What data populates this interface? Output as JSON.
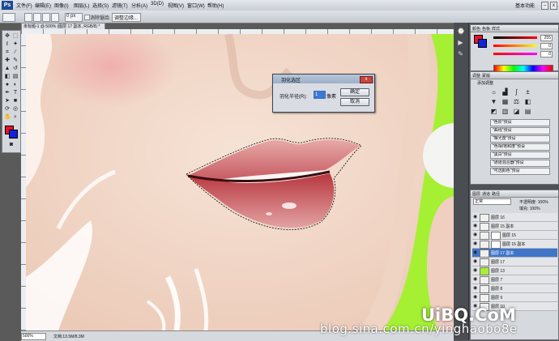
{
  "app": {
    "logo": "Ps",
    "workspace": "基本功能"
  },
  "menu": [
    "文件(F)",
    "编辑(E)",
    "图像(I)",
    "图层(L)",
    "选择(S)",
    "滤镜(T)",
    "分析(A)",
    "3D(D)",
    "视图(V)",
    "窗口(W)",
    "帮助(H)"
  ],
  "options": {
    "feather_value": "0 px",
    "antialias_label": "消除锯齿",
    "refine_edge_label": "调整边缘..."
  },
  "document": {
    "tab_title": "未标题-1 @ 500% (图层 17 副本, RGB/8) *",
    "zoom": "500%",
    "doc_size": "文档:13.5M/8.3M"
  },
  "dialog": {
    "title": "羽化选区",
    "close_label": "x",
    "field_label": "羽化半径(R):",
    "field_value": "1",
    "unit": "像素",
    "ok_label": "确定",
    "cancel_label": "取消"
  },
  "panels": {
    "color": {
      "tabs": [
        "颜色",
        "色板",
        "样式"
      ],
      "values": [
        "255",
        "0",
        "0"
      ]
    },
    "adjustments": {
      "tabs": [
        "调整",
        "蒙版"
      ],
      "header": "添加调整",
      "presets": [
        "\"色阶\"预设",
        "\"曲线\"预设",
        "\"曝光度\"预设",
        "\"色相/饱和度\"预设",
        "\"黑白\"预设",
        "\"通道混合器\"预设",
        "\"可选颜色\"预设"
      ]
    },
    "layers": {
      "tabs": [
        "图层",
        "通道",
        "路径"
      ],
      "blend_mode": "正常",
      "opacity": "不透明度: 100%",
      "fill": "填充: 100%",
      "rows": [
        {
          "name": "图层 16",
          "selected": false
        },
        {
          "name": "图层 15 副本",
          "selected": false
        },
        {
          "name": "图层 15",
          "selected": false
        },
        {
          "name": "图层 15 副本",
          "selected": false
        },
        {
          "name": "图层 17 副本",
          "selected": true
        },
        {
          "name": "图层 17",
          "selected": false
        },
        {
          "name": "图层 13",
          "selected": false
        },
        {
          "name": "图层 7",
          "selected": false
        },
        {
          "name": "图层 8",
          "selected": false
        },
        {
          "name": "图层 9",
          "selected": false
        },
        {
          "name": "图层 10",
          "selected": false
        }
      ]
    }
  },
  "watermarks": {
    "url": "blog.sina.com.cn/yinghaobo8e",
    "logo": "UiBQ.CoM"
  },
  "colors": {
    "foreground": "#e8102a",
    "background": "#1222d8",
    "canvas_green": "#a5f033",
    "selection_blue": "#3f74c9"
  }
}
